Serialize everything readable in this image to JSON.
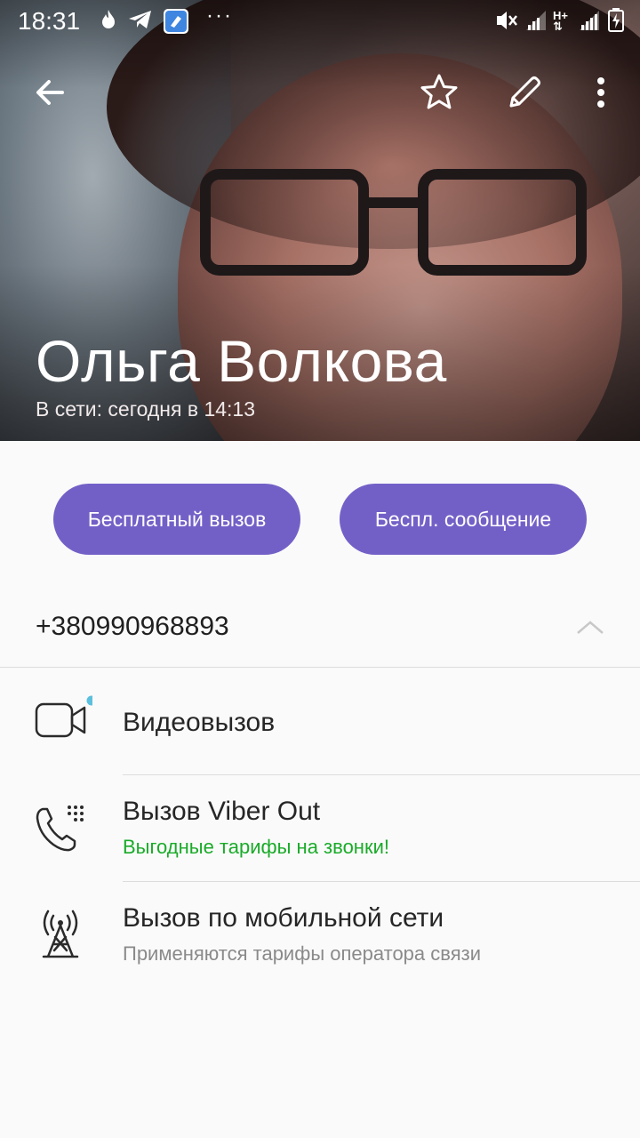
{
  "status_bar": {
    "time": "18:31",
    "more": "···",
    "icons": [
      "flame-icon",
      "telegram-icon",
      "cleaner-app-icon",
      "mute-icon",
      "signal-icon",
      "h-plus-icon",
      "signal-icon",
      "battery-icon"
    ]
  },
  "toolbar": {
    "back_icon": "arrow-left-icon",
    "favorite_icon": "star-icon",
    "edit_icon": "pencil-icon",
    "menu_icon": "more-vertical-icon"
  },
  "contact": {
    "name": "Ольга Волкова",
    "last_seen": "В сети: сегодня в 14:13"
  },
  "actions": {
    "free_call": "Бесплатный вызов",
    "free_message": "Беспл. сообщение"
  },
  "phone": {
    "number": "+380990968893"
  },
  "options": [
    {
      "title": "Видеовызов",
      "subtitle": ""
    },
    {
      "title": "Вызов Viber Out",
      "subtitle": "Выгодные тарифы на звонки!"
    },
    {
      "title": "Вызов по мобильной сети",
      "subtitle": "Применяются тарифы оператора связи"
    }
  ],
  "colors": {
    "accent": "#7360c7",
    "promo_green": "#1aab29",
    "muted_gray": "#8a8a8a",
    "badge_blue": "#5bc0de"
  }
}
